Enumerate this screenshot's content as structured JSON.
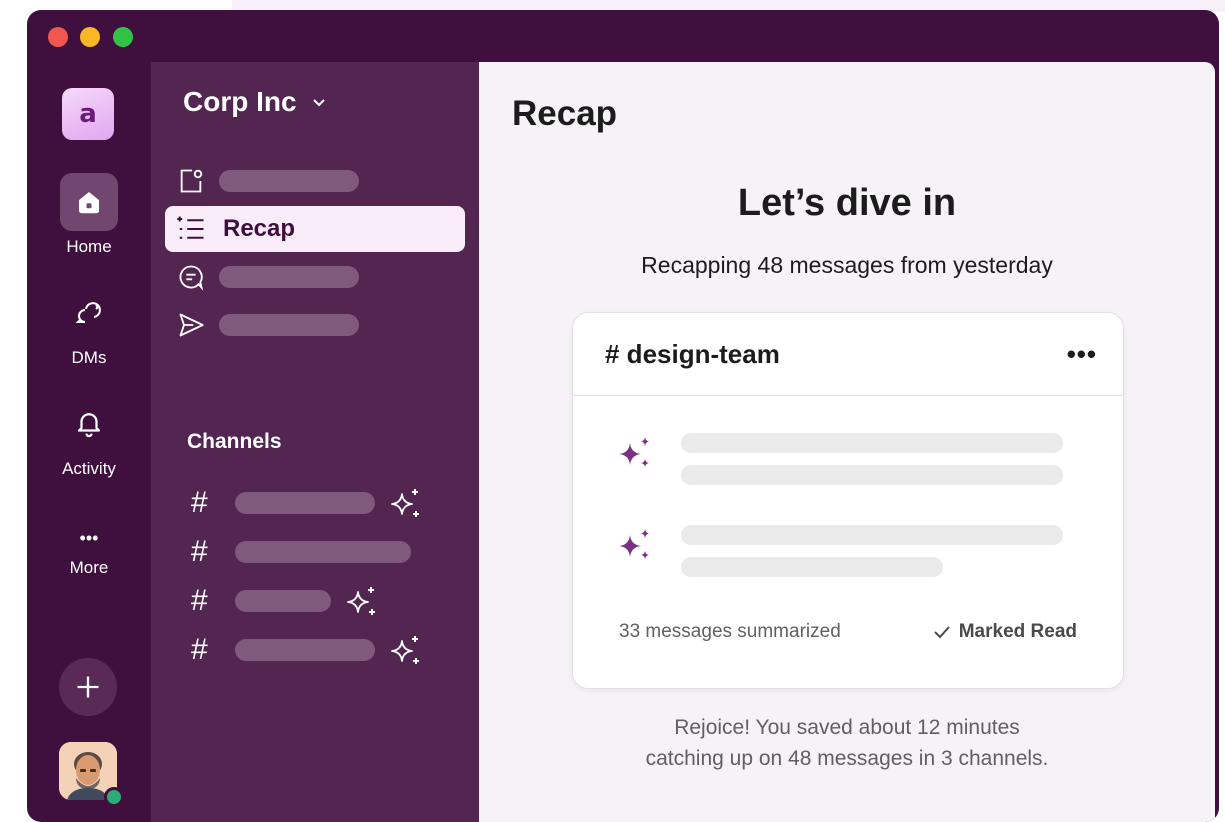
{
  "rail": {
    "workspace_initial": "a",
    "items": [
      {
        "label": "Home",
        "icon": "home-icon"
      },
      {
        "label": "DMs",
        "icon": "dms-icon"
      },
      {
        "label": "Activity",
        "icon": "bell-icon"
      },
      {
        "label": "More",
        "icon": "more-icon"
      }
    ],
    "more_glyph": "•••",
    "add_icon": "plus-icon",
    "presence_color": "#2bac76"
  },
  "sidebar": {
    "workspace_name": "Corp Inc",
    "nav_active_label": "Recap",
    "channels_header": "Channels",
    "channel_glyph": "#"
  },
  "main": {
    "title": "Recap",
    "heading": "Let’s dive in",
    "subheading": "Recapping 48 messages from yesterday",
    "card": {
      "channel": "# design-team",
      "menu_glyph": "•••",
      "summary_count": "33 messages summarized",
      "marked_read": "Marked Read"
    },
    "saved_line1": "Rejoice! You saved about 12 minutes",
    "saved_line2": "catching up on 48 messages in 3 channels."
  },
  "colors": {
    "aubergine": "#3f0f3d",
    "sidebar": "#532551",
    "sparkle": "#7c3085",
    "active_nav_bg": "#f9edf9"
  }
}
